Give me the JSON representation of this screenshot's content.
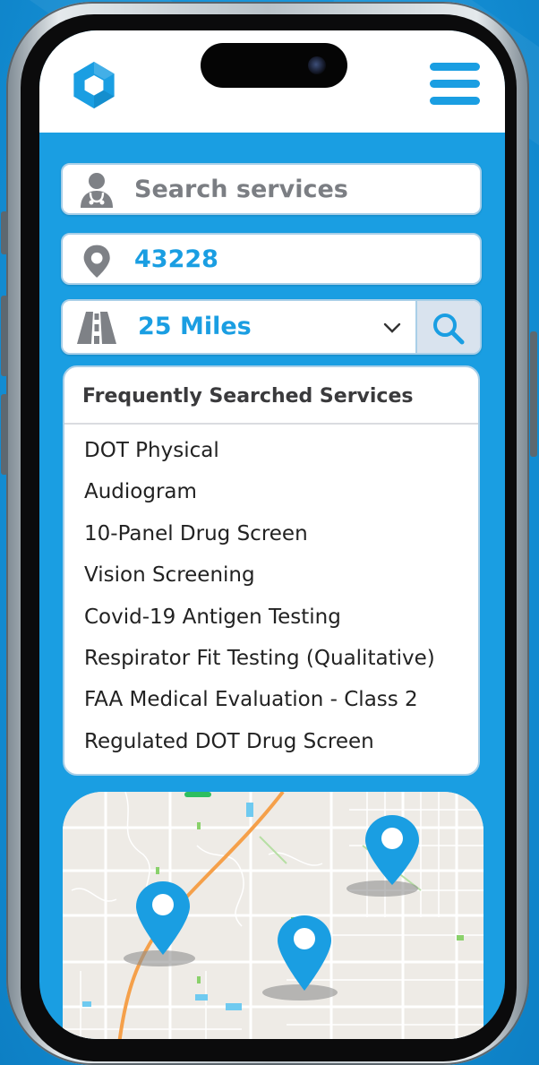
{
  "search": {
    "service_placeholder": "Search services",
    "location_value": "43228",
    "radius_value": "25 Miles",
    "search_button_icon": "magnifier-icon"
  },
  "suggestions": {
    "heading": "Frequently Searched Services",
    "items": [
      "DOT Physical",
      "Audiogram",
      "10-Panel Drug Screen",
      "Vision Screening",
      "Covid-19 Antigen Testing",
      "Respirator Fit Testing (Qualitative)",
      "FAA Medical Evaluation - Class 2",
      "Regulated DOT Drug Screen"
    ]
  },
  "icons": {
    "service": "doctor-icon",
    "location": "location-pin-icon",
    "radius": "road-icon",
    "dropdown": "chevron-down-icon",
    "menu": "hamburger-menu-icon",
    "logo": "hexagon-logo",
    "map_marker": "map-pin-icon"
  },
  "colors": {
    "brand_blue": "#1a9ee2",
    "placeholder_gray": "#7b7e83",
    "icon_gray": "#7e8186",
    "map_background": "#eeebe6",
    "highway_orange": "#f5a04a"
  }
}
